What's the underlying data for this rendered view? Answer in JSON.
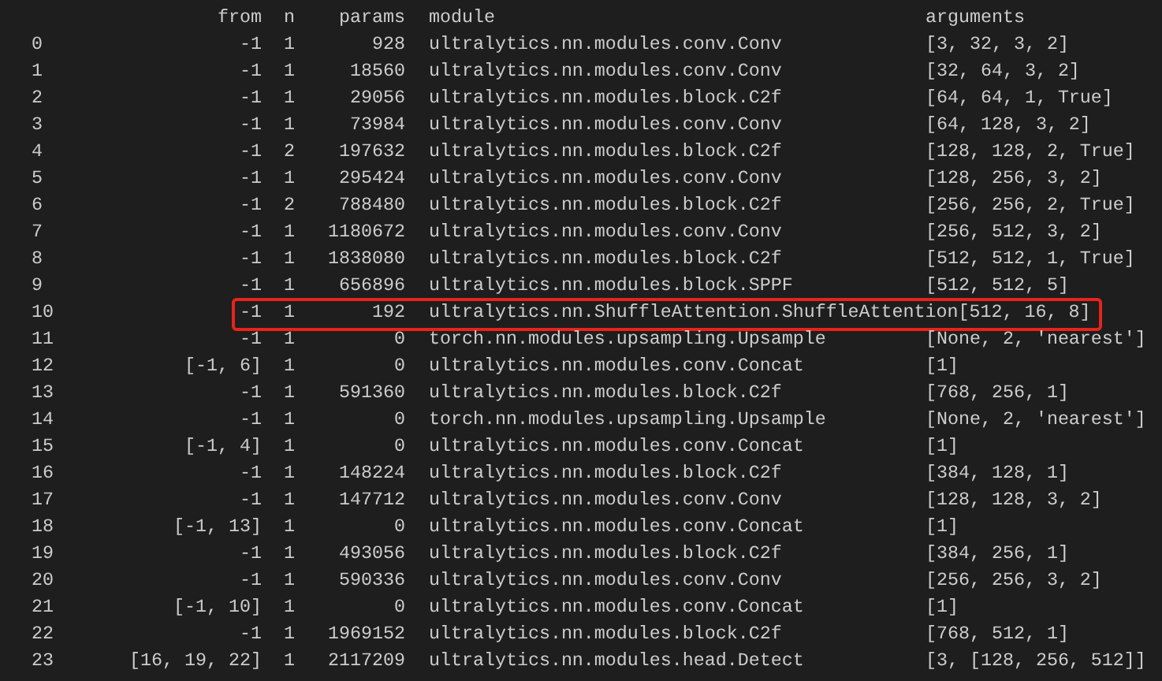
{
  "columns": [
    "from",
    "n",
    "params",
    "module",
    "arguments"
  ],
  "rows": [
    {
      "index": "0",
      "from": "-1",
      "n": "1",
      "params": "928",
      "module": "ultralytics.nn.modules.conv.Conv",
      "arguments": "[3, 32, 3, 2]",
      "highlighted": false
    },
    {
      "index": "1",
      "from": "-1",
      "n": "1",
      "params": "18560",
      "module": "ultralytics.nn.modules.conv.Conv",
      "arguments": "[32, 64, 3, 2]",
      "highlighted": false
    },
    {
      "index": "2",
      "from": "-1",
      "n": "1",
      "params": "29056",
      "module": "ultralytics.nn.modules.block.C2f",
      "arguments": "[64, 64, 1, True]",
      "highlighted": false
    },
    {
      "index": "3",
      "from": "-1",
      "n": "1",
      "params": "73984",
      "module": "ultralytics.nn.modules.conv.Conv",
      "arguments": "[64, 128, 3, 2]",
      "highlighted": false
    },
    {
      "index": "4",
      "from": "-1",
      "n": "2",
      "params": "197632",
      "module": "ultralytics.nn.modules.block.C2f",
      "arguments": "[128, 128, 2, True]",
      "highlighted": false
    },
    {
      "index": "5",
      "from": "-1",
      "n": "1",
      "params": "295424",
      "module": "ultralytics.nn.modules.conv.Conv",
      "arguments": "[128, 256, 3, 2]",
      "highlighted": false
    },
    {
      "index": "6",
      "from": "-1",
      "n": "2",
      "params": "788480",
      "module": "ultralytics.nn.modules.block.C2f",
      "arguments": "[256, 256, 2, True]",
      "highlighted": false
    },
    {
      "index": "7",
      "from": "-1",
      "n": "1",
      "params": "1180672",
      "module": "ultralytics.nn.modules.conv.Conv",
      "arguments": "[256, 512, 3, 2]",
      "highlighted": false
    },
    {
      "index": "8",
      "from": "-1",
      "n": "1",
      "params": "1838080",
      "module": "ultralytics.nn.modules.block.C2f",
      "arguments": "[512, 512, 1, True]",
      "highlighted": false
    },
    {
      "index": "9",
      "from": "-1",
      "n": "1",
      "params": "656896",
      "module": "ultralytics.nn.modules.block.SPPF",
      "arguments": "[512, 512, 5]",
      "highlighted": false
    },
    {
      "index": "10",
      "from": "-1",
      "n": "1",
      "params": "192",
      "module": "ultralytics.nn.ShuffleAttention.ShuffleAttention",
      "arguments": "[512, 16, 8]",
      "highlighted": true
    },
    {
      "index": "11",
      "from": "-1",
      "n": "1",
      "params": "0",
      "module": "torch.nn.modules.upsampling.Upsample",
      "arguments": "[None, 2, 'nearest']",
      "highlighted": false
    },
    {
      "index": "12",
      "from": "[-1, 6]",
      "n": "1",
      "params": "0",
      "module": "ultralytics.nn.modules.conv.Concat",
      "arguments": "[1]",
      "highlighted": false
    },
    {
      "index": "13",
      "from": "-1",
      "n": "1",
      "params": "591360",
      "module": "ultralytics.nn.modules.block.C2f",
      "arguments": "[768, 256, 1]",
      "highlighted": false
    },
    {
      "index": "14",
      "from": "-1",
      "n": "1",
      "params": "0",
      "module": "torch.nn.modules.upsampling.Upsample",
      "arguments": "[None, 2, 'nearest']",
      "highlighted": false
    },
    {
      "index": "15",
      "from": "[-1, 4]",
      "n": "1",
      "params": "0",
      "module": "ultralytics.nn.modules.conv.Concat",
      "arguments": "[1]",
      "highlighted": false
    },
    {
      "index": "16",
      "from": "-1",
      "n": "1",
      "params": "148224",
      "module": "ultralytics.nn.modules.block.C2f",
      "arguments": "[384, 128, 1]",
      "highlighted": false
    },
    {
      "index": "17",
      "from": "-1",
      "n": "1",
      "params": "147712",
      "module": "ultralytics.nn.modules.conv.Conv",
      "arguments": "[128, 128, 3, 2]",
      "highlighted": false
    },
    {
      "index": "18",
      "from": "[-1, 13]",
      "n": "1",
      "params": "0",
      "module": "ultralytics.nn.modules.conv.Concat",
      "arguments": "[1]",
      "highlighted": false
    },
    {
      "index": "19",
      "from": "-1",
      "n": "1",
      "params": "493056",
      "module": "ultralytics.nn.modules.block.C2f",
      "arguments": "[384, 256, 1]",
      "highlighted": false
    },
    {
      "index": "20",
      "from": "-1",
      "n": "1",
      "params": "590336",
      "module": "ultralytics.nn.modules.conv.Conv",
      "arguments": "[256, 256, 3, 2]",
      "highlighted": false
    },
    {
      "index": "21",
      "from": "[-1, 10]",
      "n": "1",
      "params": "0",
      "module": "ultralytics.nn.modules.conv.Concat",
      "arguments": "[1]",
      "highlighted": false
    },
    {
      "index": "22",
      "from": "-1",
      "n": "1",
      "params": "1969152",
      "module": "ultralytics.nn.modules.block.C2f",
      "arguments": "[768, 512, 1]",
      "highlighted": false
    },
    {
      "index": "23",
      "from": "[16, 19, 22]",
      "n": "1",
      "params": "2117209",
      "module": "ultralytics.nn.modules.head.Detect",
      "arguments": "[3, [128, 256, 512]]",
      "highlighted": false
    }
  ]
}
